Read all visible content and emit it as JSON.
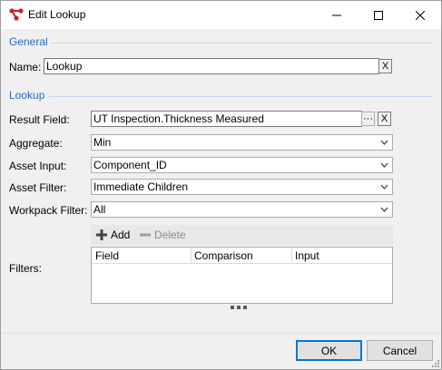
{
  "window": {
    "title": "Edit Lookup",
    "icon": "app-logo-icon",
    "controls": [
      "minimize-icon",
      "maximize-icon",
      "close-icon"
    ]
  },
  "general": {
    "section_label": "General",
    "name_label": "Name:",
    "name_value": "Lookup",
    "clear_label": "X"
  },
  "lookup": {
    "section_label": "Lookup",
    "result_field_label": "Result Field:",
    "result_field_value": "UT Inspection.Thickness Measured",
    "browse_label": "···",
    "clear_label": "X",
    "aggregate_label": "Aggregate:",
    "aggregate_value": "Min",
    "asset_input_label": "Asset Input:",
    "asset_input_value": "Component_ID",
    "asset_filter_label": "Asset Filter:",
    "asset_filter_value": "Immediate Children",
    "workpack_filter_label": "Workpack Filter:",
    "workpack_filter_value": "All"
  },
  "filters": {
    "label": "Filters:",
    "add_label": "Add",
    "delete_label": "Delete",
    "columns": [
      "Field",
      "Comparison",
      "Input"
    ],
    "rows": []
  },
  "footer": {
    "ok_label": "OK",
    "cancel_label": "Cancel"
  },
  "colors": {
    "section_text": "#2a6bbf",
    "accent_border": "#0078d7",
    "logo_red": "#c8232c"
  }
}
